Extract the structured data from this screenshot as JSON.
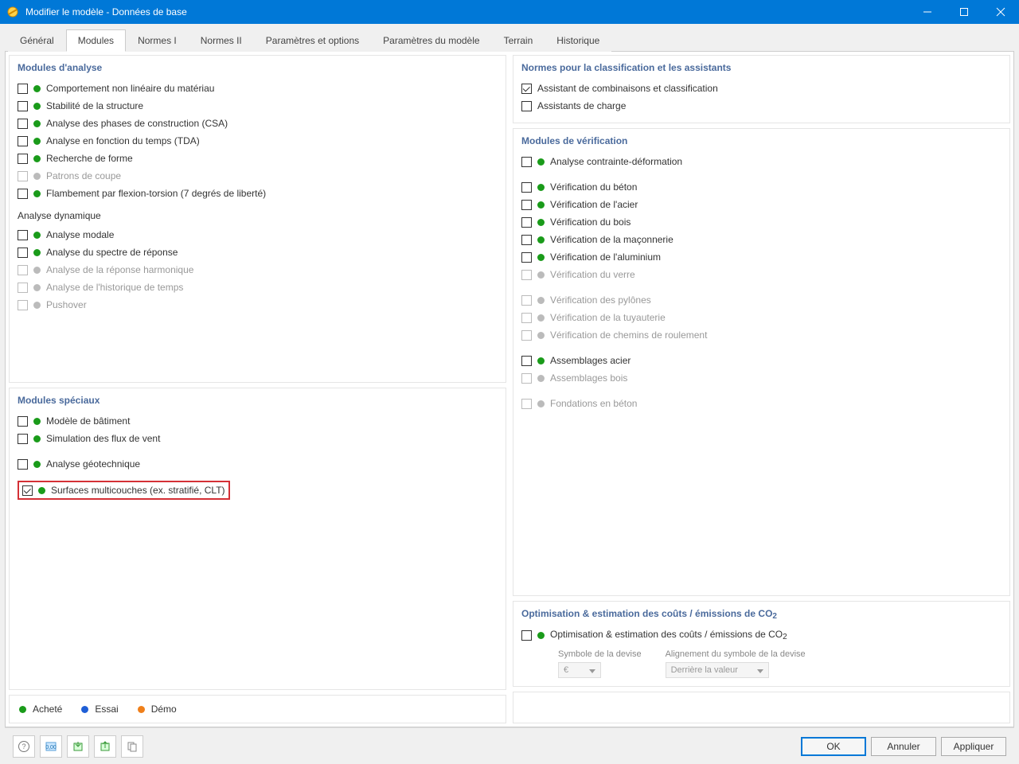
{
  "window": {
    "title": "Modifier le modèle - Données de base"
  },
  "tabs": [
    "Général",
    "Modules",
    "Normes I",
    "Normes II",
    "Paramètres et options",
    "Paramètres du modèle",
    "Terrain",
    "Historique"
  ],
  "active_tab": 1,
  "left": {
    "analysis": {
      "title": "Modules d'analyse",
      "items": [
        {
          "label": "Comportement non linéaire du matériau",
          "dot": "green",
          "checked": false,
          "enabled": true
        },
        {
          "label": "Stabilité de la structure",
          "dot": "green",
          "checked": false,
          "enabled": true
        },
        {
          "label": "Analyse des phases de construction (CSA)",
          "dot": "green",
          "checked": false,
          "enabled": true
        },
        {
          "label": "Analyse en fonction du temps (TDA)",
          "dot": "green",
          "checked": false,
          "enabled": true
        },
        {
          "label": "Recherche de forme",
          "dot": "green",
          "checked": false,
          "enabled": true
        },
        {
          "label": "Patrons de coupe",
          "dot": "gray",
          "checked": false,
          "enabled": false
        },
        {
          "label": "Flambement par flexion-torsion (7 degrés de liberté)",
          "dot": "green",
          "checked": false,
          "enabled": true
        }
      ],
      "dynamic_title": "Analyse dynamique",
      "dyn_items": [
        {
          "label": "Analyse modale",
          "dot": "green",
          "checked": false,
          "enabled": true
        },
        {
          "label": "Analyse du spectre de réponse",
          "dot": "green",
          "checked": false,
          "enabled": true
        },
        {
          "label": "Analyse de la réponse harmonique",
          "dot": "gray",
          "checked": false,
          "enabled": false
        },
        {
          "label": "Analyse de l'historique de temps",
          "dot": "gray",
          "checked": false,
          "enabled": false
        },
        {
          "label": "Pushover",
          "dot": "gray",
          "checked": false,
          "enabled": false
        }
      ]
    },
    "special": {
      "title": "Modules spéciaux",
      "items": [
        {
          "label": "Modèle de bâtiment",
          "dot": "green",
          "checked": false,
          "enabled": true,
          "hl": false
        },
        {
          "label": "Simulation des flux de vent",
          "dot": "green",
          "checked": false,
          "enabled": true,
          "hl": false
        },
        {
          "label": "Analyse géotechnique",
          "dot": "green",
          "checked": false,
          "enabled": true,
          "hl": false,
          "gap": true
        },
        {
          "label": "Surfaces multicouches (ex. stratifié, CLT)",
          "dot": "green",
          "checked": true,
          "enabled": true,
          "hl": true,
          "gap": true
        }
      ]
    }
  },
  "right": {
    "norms": {
      "title": "Normes pour la classification et les assistants",
      "items": [
        {
          "label": "Assistant de combinaisons et classification",
          "checked": true
        },
        {
          "label": "Assistants de charge",
          "checked": false
        }
      ]
    },
    "verify": {
      "title": "Modules de vérification",
      "top": [
        {
          "label": "Analyse contrainte-déformation",
          "dot": "green",
          "enabled": true
        }
      ],
      "group1": [
        {
          "label": "Vérification du béton",
          "dot": "green",
          "enabled": true
        },
        {
          "label": "Vérification de l'acier",
          "dot": "green",
          "enabled": true
        },
        {
          "label": "Vérification du bois",
          "dot": "green",
          "enabled": true
        },
        {
          "label": "Vérification de la maçonnerie",
          "dot": "green",
          "enabled": true
        },
        {
          "label": "Vérification de l'aluminium",
          "dot": "green",
          "enabled": true
        },
        {
          "label": "Vérification du verre",
          "dot": "gray",
          "enabled": false
        }
      ],
      "group2": [
        {
          "label": "Vérification des pylônes",
          "dot": "gray",
          "enabled": false
        },
        {
          "label": "Vérification de la tuyauterie",
          "dot": "gray",
          "enabled": false
        },
        {
          "label": "Vérification de chemins de roulement",
          "dot": "gray",
          "enabled": false
        }
      ],
      "group3": [
        {
          "label": "Assemblages acier",
          "dot": "green",
          "enabled": true
        },
        {
          "label": "Assemblages bois",
          "dot": "gray",
          "enabled": false
        }
      ],
      "group4": [
        {
          "label": "Fondations en béton",
          "dot": "gray",
          "enabled": false
        }
      ]
    },
    "opt": {
      "title": "Optimisation & estimation des coûts / émissions de CO",
      "title_sub": "2",
      "item": {
        "label": "Optimisation & estimation des coûts / émissions de CO",
        "sub": "2",
        "dot": "green"
      },
      "col1_label": "Symbole de la devise",
      "col1_value": "€",
      "col2_label": "Alignement du symbole de la devise",
      "col2_value": "Derrière la valeur"
    }
  },
  "legend": {
    "purchased": "Acheté",
    "trial": "Essai",
    "demo": "Démo"
  },
  "buttons": {
    "ok": "OK",
    "cancel": "Annuler",
    "apply": "Appliquer"
  }
}
